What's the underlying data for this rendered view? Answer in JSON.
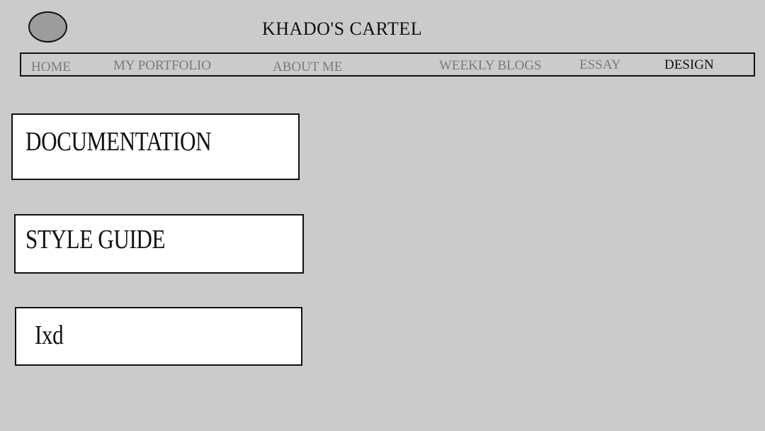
{
  "header": {
    "title": "KHADO'S CARTEL"
  },
  "nav": {
    "items": [
      {
        "label": "HOME"
      },
      {
        "label": "MY PORTFOLIO"
      },
      {
        "label": "ABOUT ME"
      },
      {
        "label": "WEEKLY BLOGS"
      },
      {
        "label": "ESSAY"
      },
      {
        "label": "DESIGN"
      }
    ],
    "active": "DESIGN"
  },
  "cards": [
    {
      "label": "DOCUMENTATION"
    },
    {
      "label": "STYLE GUIDE"
    },
    {
      "label": "Ixd"
    }
  ],
  "colors": {
    "background": "#cbcbcb",
    "logo_fill": "#9c9c9c",
    "nav_inactive": "#7a7a7a",
    "nav_active": "#111111",
    "card_fill": "#ffffff"
  }
}
